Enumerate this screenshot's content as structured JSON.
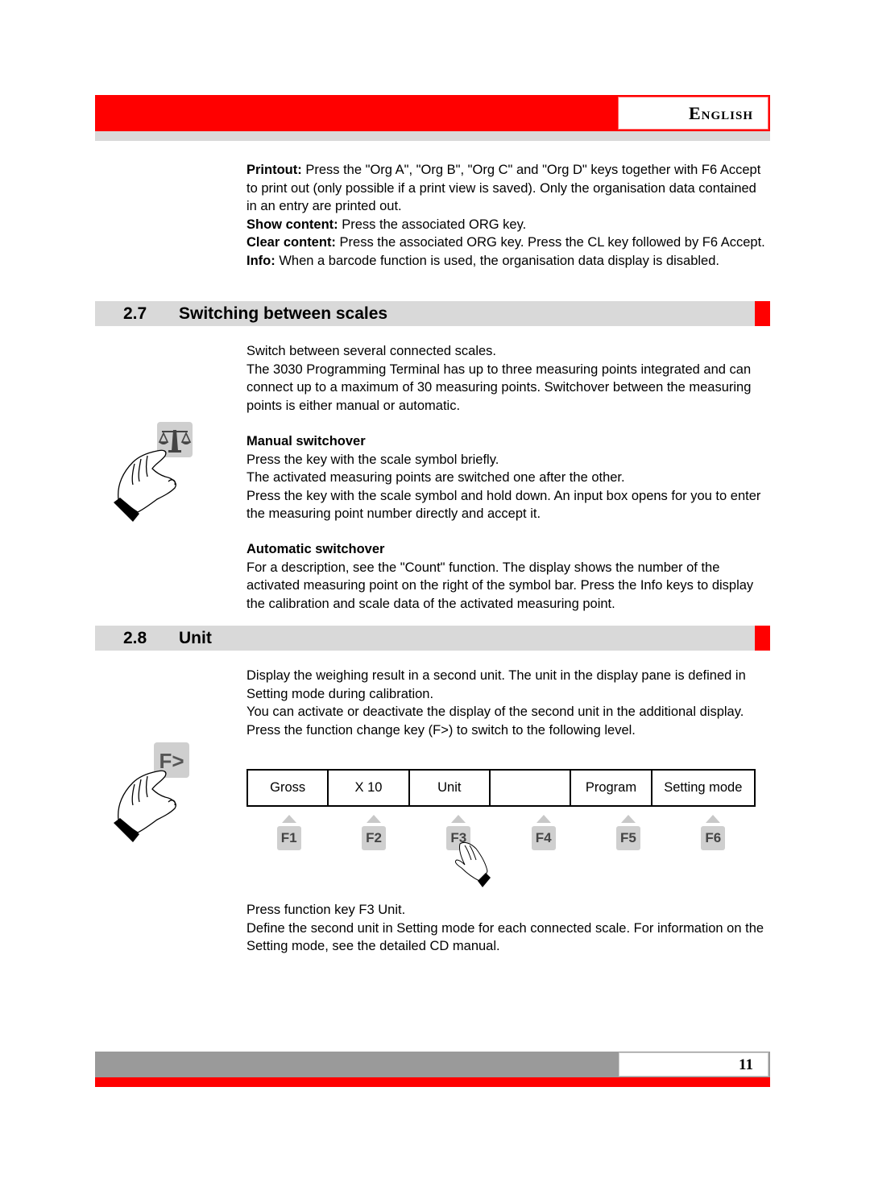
{
  "header": {
    "language": "English"
  },
  "intro": {
    "paragraphs": [
      {
        "label": "Printout:",
        "text": " Press the \"Org A\", \"Org B\", \"Org C\" and \"Org D\" keys together with F6 Accept to print out (only possible if a print view is saved). Only the organisation data contained in an entry are printed out."
      },
      {
        "label": "Show content:",
        "text": " Press the associated ORG key."
      },
      {
        "label": "Clear content:",
        "text": " Press the associated ORG key. Press the CL key followed by F6 Accept."
      },
      {
        "label": "Info:",
        "text": " When a barcode function is used, the organisation data display is disabled."
      }
    ]
  },
  "section_2_7": {
    "number": "2.7",
    "title": "Switching between scales",
    "intro": [
      "Switch between several connected scales.",
      "The 3030 Programming Terminal has up to three measuring points integrated and can connect up to a maximum of 30 measuring points. Switchover between the measuring points is either manual or automatic."
    ],
    "manual": {
      "heading": "Manual switchover",
      "lines": [
        "Press the key with the scale symbol briefly.",
        "The activated measuring points are switched one after the other.",
        "Press the key with the scale symbol and hold down. An input box opens for you to enter the measuring point number directly and accept it."
      ]
    },
    "automatic": {
      "heading": "Automatic switchover",
      "text": "For a description, see the \"Count\" function. The display shows the number of the activated measuring point on the right of the symbol bar. Press the Info keys to display the calibration and scale data of the activated measuring point."
    },
    "illustration": {
      "key_icon": "scale-icon"
    }
  },
  "section_2_8": {
    "number": "2.8",
    "title": "Unit",
    "intro": [
      "Display the weighing result in a second unit. The unit in the display pane is defined in Setting mode during calibration.",
      "You can activate or deactivate the display of the second unit in the additional display.",
      "Press the function change key (F>) to switch to the following level."
    ],
    "illustration": {
      "key_label": "F>"
    },
    "function_bar": [
      {
        "label": "Gross",
        "key": "F1"
      },
      {
        "label": "X 10",
        "key": "F2"
      },
      {
        "label": "Unit",
        "key": "F3"
      },
      {
        "label": "",
        "key": "F4"
      },
      {
        "label": "Program",
        "key": "F5"
      },
      {
        "label": "Setting mode",
        "key": "F6"
      }
    ],
    "pressed_key": "F3",
    "outro": [
      "Press function key F3 Unit.",
      "Define the second unit in Setting mode for each connected scale. For information on the Setting mode, see the detailed CD manual."
    ]
  },
  "footer": {
    "page_number": "11"
  }
}
